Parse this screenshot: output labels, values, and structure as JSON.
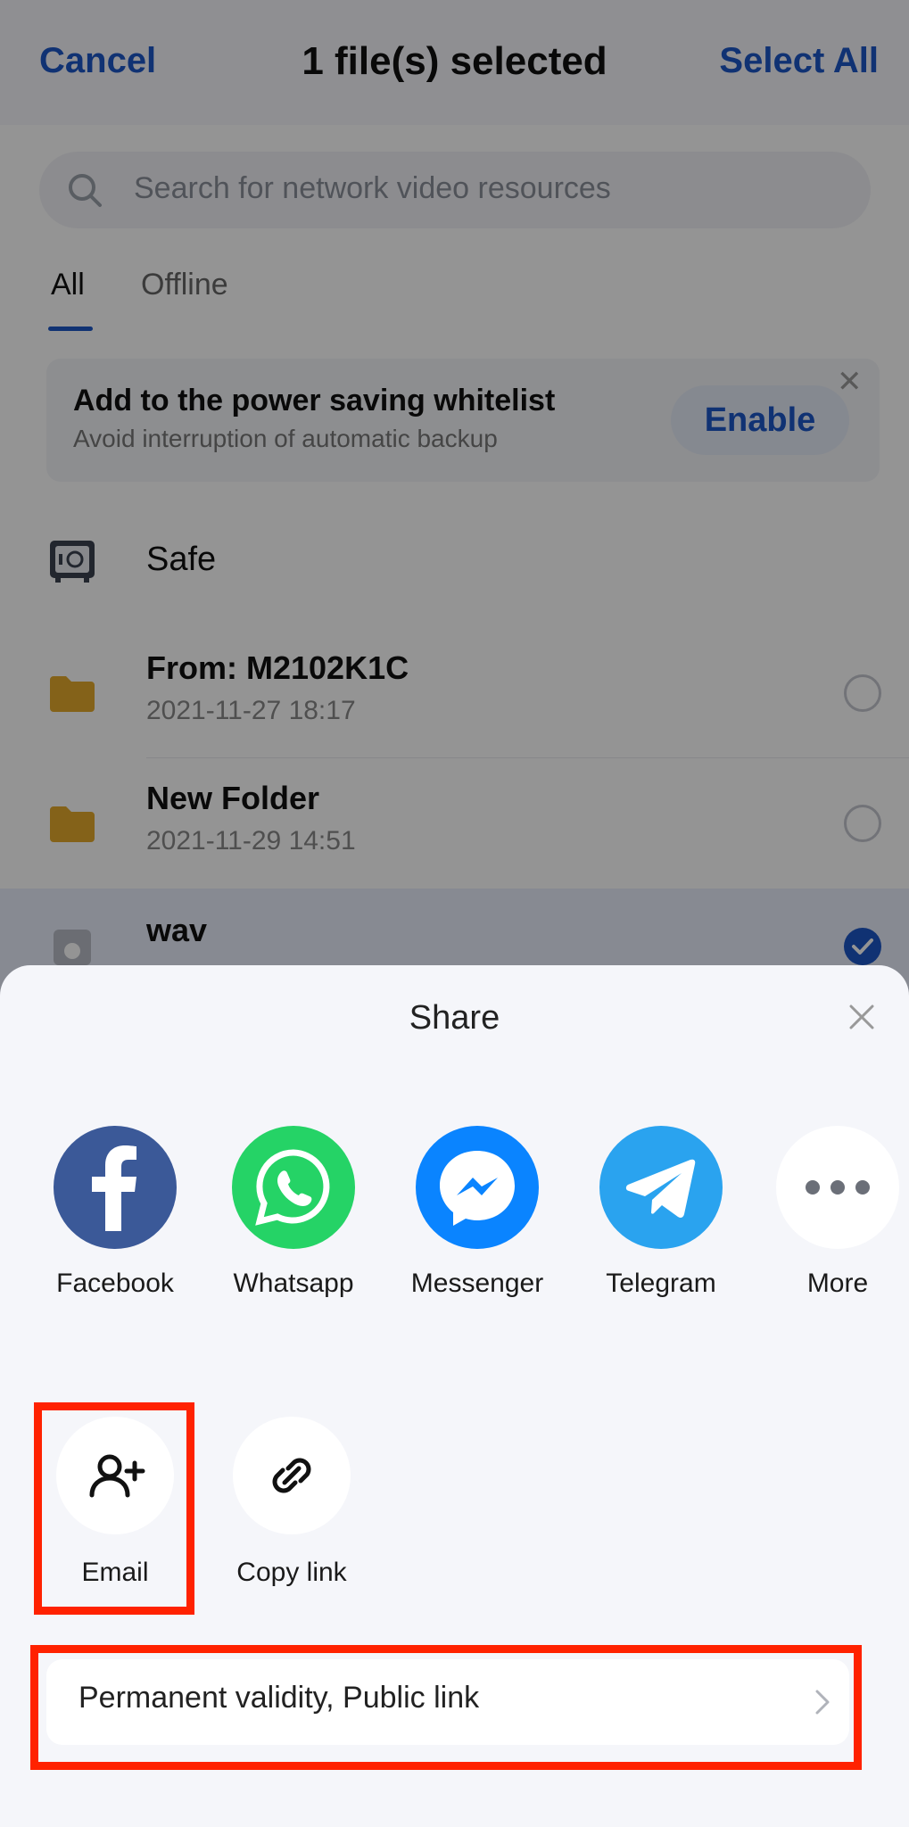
{
  "header": {
    "cancel_label": "Cancel",
    "title": "1 file(s) selected",
    "select_all_label": "Select All"
  },
  "search": {
    "placeholder": "Search for network video resources"
  },
  "tabs": [
    {
      "label": "All",
      "active": true
    },
    {
      "label": "Offline",
      "active": false
    }
  ],
  "banner": {
    "title": "Add to the power saving whitelist",
    "subtitle": "Avoid interruption of automatic backup",
    "enable_label": "Enable"
  },
  "files": [
    {
      "name": "Safe",
      "date": "",
      "icon": "safe-icon"
    },
    {
      "name": "From: M2102K1C",
      "date": "2021-11-27  18:17",
      "icon": "folder-icon"
    },
    {
      "name": "New Folder",
      "date": "2021-11-29  14:51",
      "icon": "folder-icon"
    },
    {
      "name": "wav",
      "date": "",
      "icon": "audio-file-icon",
      "selected": true
    }
  ],
  "share": {
    "title": "Share",
    "apps": [
      {
        "label": "Facebook",
        "icon": "facebook-icon",
        "color": "#3b5998"
      },
      {
        "label": "Whatsapp",
        "icon": "whatsapp-icon",
        "color": "#25d366"
      },
      {
        "label": "Messenger",
        "icon": "messenger-icon",
        "color": "#0a84ff"
      },
      {
        "label": "Telegram",
        "icon": "telegram-icon",
        "color": "#2aa3ef"
      },
      {
        "label": "More",
        "icon": "more-icon",
        "color": "#ffffff"
      }
    ],
    "actions": [
      {
        "label": "Email",
        "icon": "add-person-icon"
      },
      {
        "label": "Copy link",
        "icon": "link-icon"
      }
    ],
    "link_setting": "Permanent validity, Public link"
  },
  "colors": {
    "accent": "#1d56c7",
    "highlight": "#ff2200"
  }
}
